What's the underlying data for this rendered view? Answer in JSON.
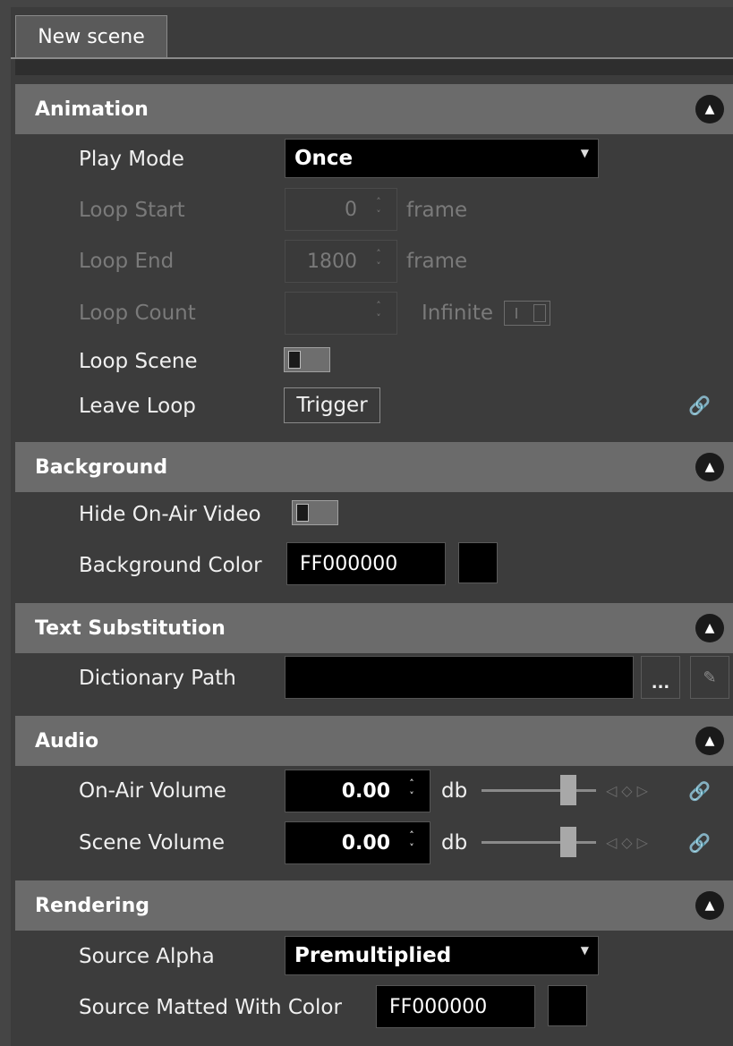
{
  "tab": {
    "label": "New scene"
  },
  "sections": {
    "animation": {
      "title": "Animation"
    },
    "background": {
      "title": "Background"
    },
    "text_substitution": {
      "title": "Text Substitution"
    },
    "audio": {
      "title": "Audio"
    },
    "rendering": {
      "title": "Rendering"
    }
  },
  "collapse_icon": "▲",
  "animation": {
    "play_mode": {
      "label": "Play Mode",
      "value": "Once"
    },
    "loop_start": {
      "label": "Loop Start",
      "value": "0",
      "unit": "frame"
    },
    "loop_end": {
      "label": "Loop End",
      "value": "1800",
      "unit": "frame"
    },
    "loop_count": {
      "label": "Loop Count",
      "value": "",
      "infinite_label": "Infinite"
    },
    "loop_scene": {
      "label": "Loop Scene"
    },
    "leave_loop": {
      "label": "Leave Loop",
      "button": "Trigger"
    }
  },
  "background": {
    "hide_video": {
      "label": "Hide On-Air Video"
    },
    "color": {
      "label": "Background Color",
      "value": "FF000000",
      "swatch": "#000000"
    }
  },
  "text_substitution": {
    "dictionary_path": {
      "label": "Dictionary Path",
      "value": "",
      "browse_label": "..."
    }
  },
  "audio": {
    "on_air_volume": {
      "label": "On-Air Volume",
      "value": "0.00",
      "unit": "db"
    },
    "scene_volume": {
      "label": "Scene Volume",
      "value": "0.00",
      "unit": "db"
    }
  },
  "rendering": {
    "source_alpha": {
      "label": "Source Alpha",
      "value": "Premultiplied"
    },
    "matted_color": {
      "label": "Source Matted With Color",
      "value": "FF000000",
      "swatch": "#000000"
    }
  },
  "icons": {
    "link": "link-icon",
    "spin_arrows": "˄˅",
    "keyframe_nav": "◁◇▷"
  }
}
